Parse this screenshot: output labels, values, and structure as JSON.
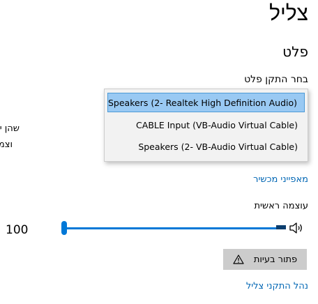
{
  "page": {
    "title": "צליל",
    "output_section": "פלט",
    "choose_device_label": "בחר התקן פלט",
    "desc_line1": "שהן ישתמשו בהתקני קול",
    "desc_line2": "וצמת הקול וההתקנים ש"
  },
  "dropdown": {
    "options": [
      {
        "label": "Speakers (2- Realtek High Definition Audio)",
        "selected": true
      },
      {
        "label": "CABLE Input (VB-Audio Virtual Cable)",
        "selected": false
      },
      {
        "label": "Speakers (2- VB-Audio Virtual Cable)",
        "selected": false
      }
    ]
  },
  "device_properties_link": "מאפייני מכשיר",
  "master_volume": {
    "label": "עוצמה ראשית",
    "value": "100",
    "level": 1.0,
    "icon": "speaker-icon"
  },
  "troubleshoot": {
    "label": "פתור בעיות",
    "icon": "warning-icon"
  },
  "manage_devices_link": "נהל התקני צליל",
  "colors": {
    "accent": "#0078d7",
    "link": "#0066b4",
    "selected_option": "#99c9f3",
    "button_bg": "#cccccc"
  }
}
